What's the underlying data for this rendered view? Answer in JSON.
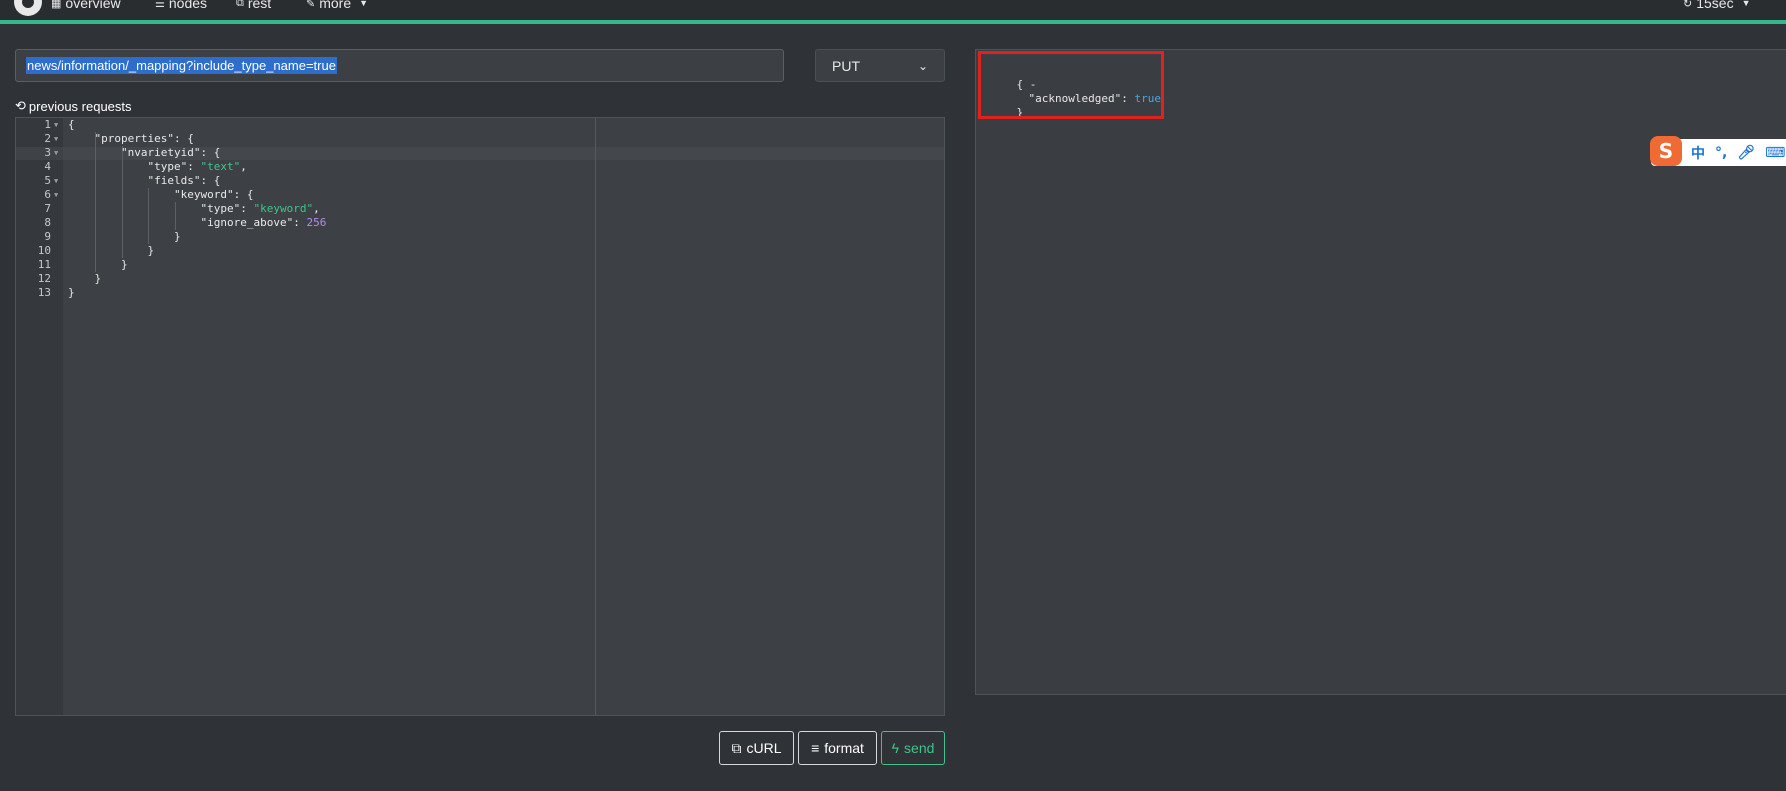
{
  "nav": {
    "items": [
      {
        "icon": "dashboard-icon",
        "label": "overview"
      },
      {
        "icon": "server-icon",
        "label": "nodes"
      },
      {
        "icon": "external-link-icon",
        "label": "rest"
      },
      {
        "icon": "wrench-icon",
        "label": "more"
      }
    ],
    "refresh_label": "15sec",
    "accent_color": "#36b78a"
  },
  "request": {
    "url": "news/information/_mapping?include_type_name=true",
    "method": "PUT",
    "previous_requests_label": "previous requests"
  },
  "editor": {
    "lines": [
      {
        "n": "1",
        "fold": true
      },
      {
        "n": "2",
        "fold": true
      },
      {
        "n": "3",
        "fold": true
      },
      {
        "n": "4",
        "fold": false
      },
      {
        "n": "5",
        "fold": true
      },
      {
        "n": "6",
        "fold": true
      },
      {
        "n": "7",
        "fold": false
      },
      {
        "n": "8",
        "fold": false
      },
      {
        "n": "9",
        "fold": false
      },
      {
        "n": "10",
        "fold": false
      },
      {
        "n": "11",
        "fold": false
      },
      {
        "n": "12",
        "fold": false
      },
      {
        "n": "13",
        "fold": false
      }
    ],
    "text": {
      "l1": "{",
      "l2_key": "\"properties\"",
      "l2_rest": ": {",
      "l3_key": "\"nvarietyid\"",
      "l3_rest": ": {",
      "l4_key": "\"type\"",
      "l4_sep": ": ",
      "l4_val": "\"text\"",
      "l4_end": ",",
      "l5_key": "\"fields\"",
      "l5_rest": ": {",
      "l6_key": "\"keyword\"",
      "l6_rest": ": {",
      "l7_key": "\"type\"",
      "l7_sep": ": ",
      "l7_val": "\"keyword\"",
      "l7_end": ",",
      "l8_key": "\"ignore_above\"",
      "l8_sep": ": ",
      "l8_val": "256",
      "l9": "}",
      "l10": "}",
      "l11": "}",
      "l12": "}",
      "l13": "}"
    }
  },
  "buttons": {
    "curl": "cURL",
    "format": "format",
    "send": "send"
  },
  "response": {
    "open": "{ -",
    "key": "\"acknowledged\"",
    "sep": ": ",
    "value": "true",
    "close": "}",
    "highlight_color": "#e0221e"
  },
  "ime": {
    "logo": "S",
    "items": [
      "中",
      "°,",
      "mic-icon",
      "keyboard-icon"
    ]
  }
}
